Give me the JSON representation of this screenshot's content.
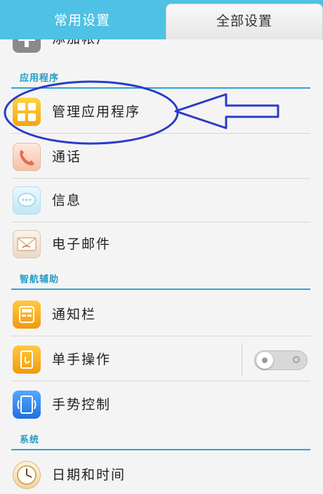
{
  "tabs": {
    "common": "常用设置",
    "all": "全部设置"
  },
  "rows": {
    "add_account": "添加帐户",
    "manage_apps": "管理应用程序",
    "call": "通话",
    "message": "信息",
    "email": "电子邮件",
    "notification_bar": "通知栏",
    "one_hand": "单手操作",
    "gesture": "手势控制",
    "date_time": "日期和时间"
  },
  "sections": {
    "apps": "应用程序",
    "assist": "智航辅助",
    "system": "系统"
  },
  "toggles": {
    "one_hand_enabled": false
  },
  "icons": {
    "add_account": "add-account-icon",
    "manage_apps": "grid-apps-icon",
    "call": "phone-icon",
    "message": "chat-bubble-icon",
    "email": "envelope-icon",
    "notification_bar": "notification-bar-icon",
    "one_hand": "one-hand-icon",
    "gesture": "gesture-icon",
    "date_time": "clock-icon"
  },
  "colors": {
    "tab_bar": "#4fc1e4",
    "section_accent": "#2ca6d3",
    "annotation": "#2a3cc8"
  }
}
